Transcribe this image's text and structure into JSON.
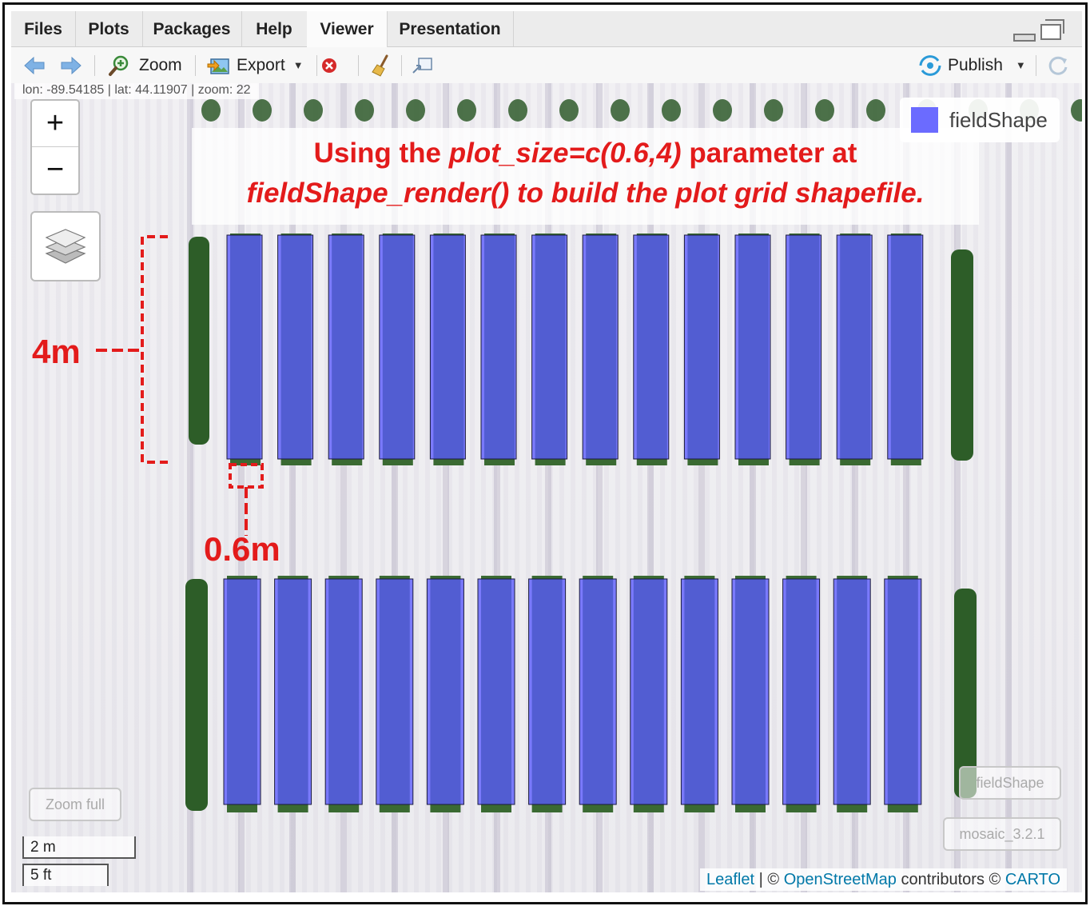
{
  "tabs": [
    "Files",
    "Plots",
    "Packages",
    "Help",
    "Viewer",
    "Presentation"
  ],
  "active_tab": "Viewer",
  "toolbar": {
    "zoom_label": "Zoom",
    "export_label": "Export",
    "publish_label": "Publish"
  },
  "coords_text": "lon: -89.54185 | lat: 44.11907 | zoom: 22",
  "map": {
    "zoom_in": "+",
    "zoom_out": "−",
    "legend_label": "fieldShape",
    "legend_color": "#6b6bff",
    "plot_fill": "#5a5aff",
    "annotation_line1_pre": "Using the ",
    "annotation_line1_em": "plot_size=c(0.6,4)",
    "annotation_line1_post": " parameter at",
    "annotation_line2_em": "fieldShape_render()",
    "annotation_line2_post": " to build the plot grid shapefile.",
    "label_4m": "4m",
    "label_06m": "0.6m",
    "zoom_full": "Zoom full",
    "toggle_fieldshape": "fieldShape",
    "toggle_mosaic": "mosaic_3.2.1",
    "scale_m": "2 m",
    "scale_ft": "5 ft",
    "attribution_leaflet": "Leaflet",
    "attribution_osm": "OpenStreetMap",
    "attribution_mid": "contributors ©",
    "attribution_carto": "CARTO",
    "attribution_sep": "| ©"
  }
}
